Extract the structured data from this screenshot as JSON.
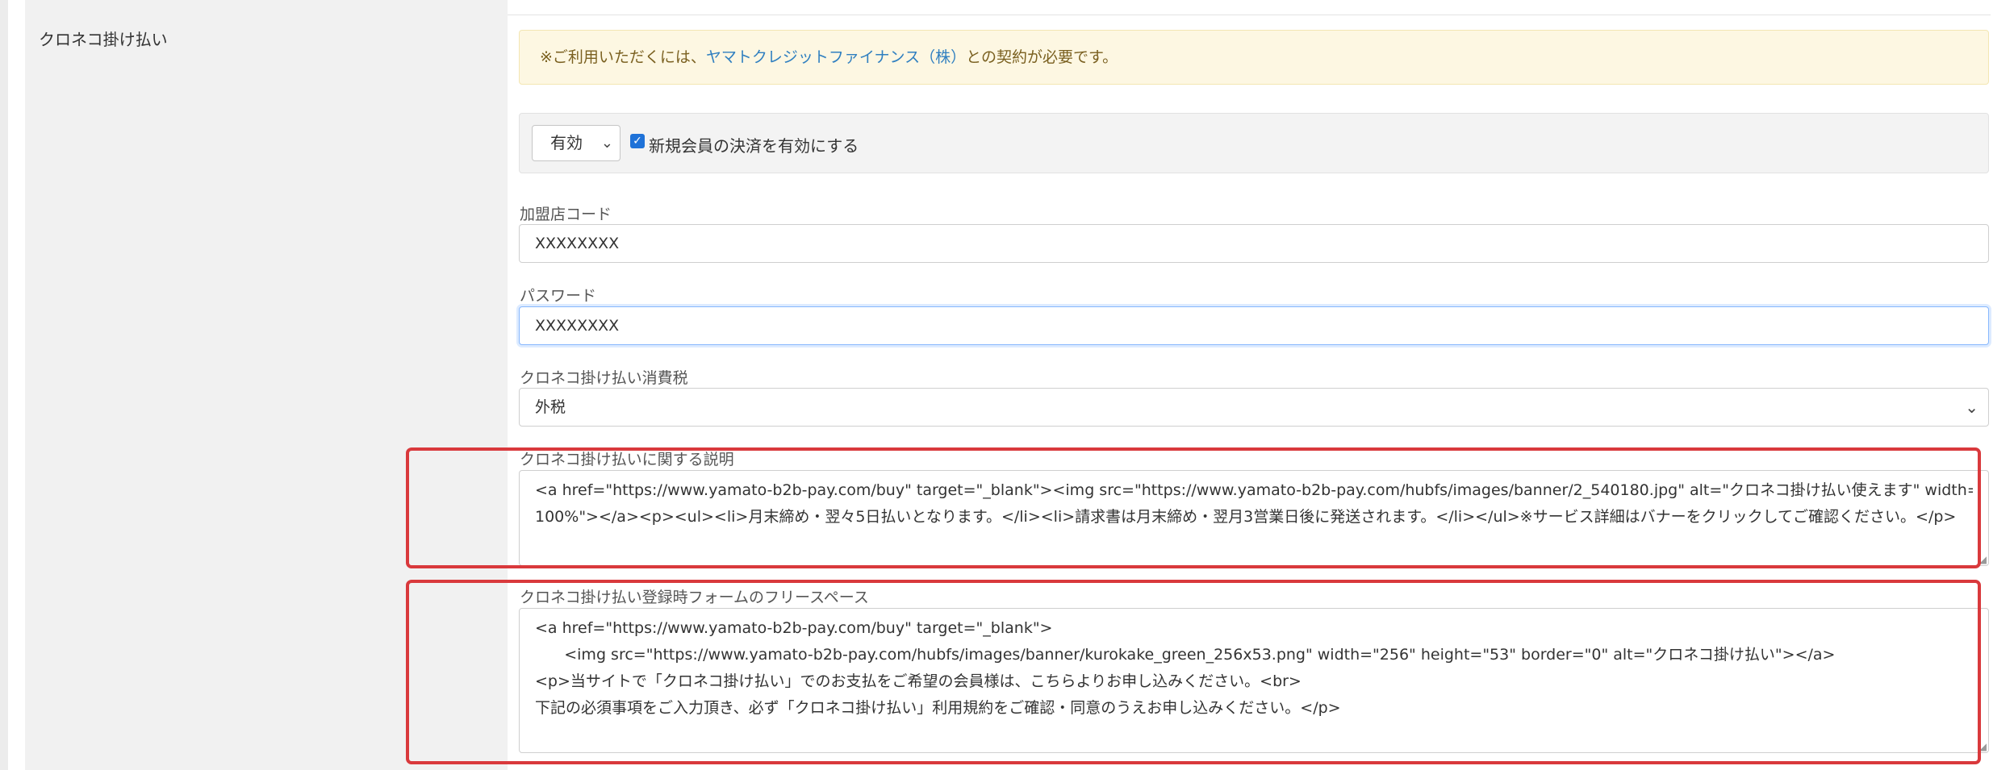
{
  "section": {
    "title": "クロネコ掛け払い"
  },
  "notice": {
    "prefix": "※ご利用いただくには、",
    "link": "ヤマトクレジットファイナンス（株）",
    "suffix": "との契約が必要です。"
  },
  "status": {
    "select_value": "有効",
    "checkbox_checked": true,
    "checkbox_label": "新規会員の決済を有効にする"
  },
  "merchant_code": {
    "label": "加盟店コード",
    "value": "XXXXXXXX"
  },
  "password": {
    "label": "パスワード",
    "value": "XXXXXXXX"
  },
  "tax": {
    "label": "クロネコ掛け払い消費税",
    "value": "外税"
  },
  "description": {
    "label": "クロネコ掛け払いに関する説明",
    "lines": [
      "<a href=\"https://www.yamato-b2b-pay.com/buy\" target=\"_blank\"><img src=\"https://www.yamato-b2b-pay.com/hubfs/images/banner/2_540180.jpg\" alt=\"クロネコ掛け払い使えます\" width=",
      "100%\"></a><p><ul><li>月末締め・翌々5日払いとなります。</li><li>請求書は月末締め・翌月3営業日後に発送されます。</li></ul>※サービス詳細はバナーをクリックしてご確認ください。</p>"
    ]
  },
  "free_space": {
    "label": "クロネコ掛け払い登録時フォームのフリースペース",
    "lines": [
      "<a href=\"https://www.yamato-b2b-pay.com/buy\" target=\"_blank\">",
      "      <img src=\"https://www.yamato-b2b-pay.com/hubfs/images/banner/kurokake_green_256x53.png\" width=\"256\" height=\"53\" border=\"0\" alt=\"クロネコ掛け払い\"></a>",
      "<p>当サイトで「クロネコ掛け払い」でのお支払をご希望の会員様は、こちらよりお申し込みください。<br>",
      "下記の必須事項をご入力頂き、必ず「クロネコ掛け払い」利用規約をご確認・同意のうえお申し込みください。</p>"
    ]
  },
  "colors": {
    "highlight": "#d9393c",
    "notice_bg": "#fdf7e2",
    "link": "#2f7fc0",
    "checkbox": "#1f72d8"
  }
}
